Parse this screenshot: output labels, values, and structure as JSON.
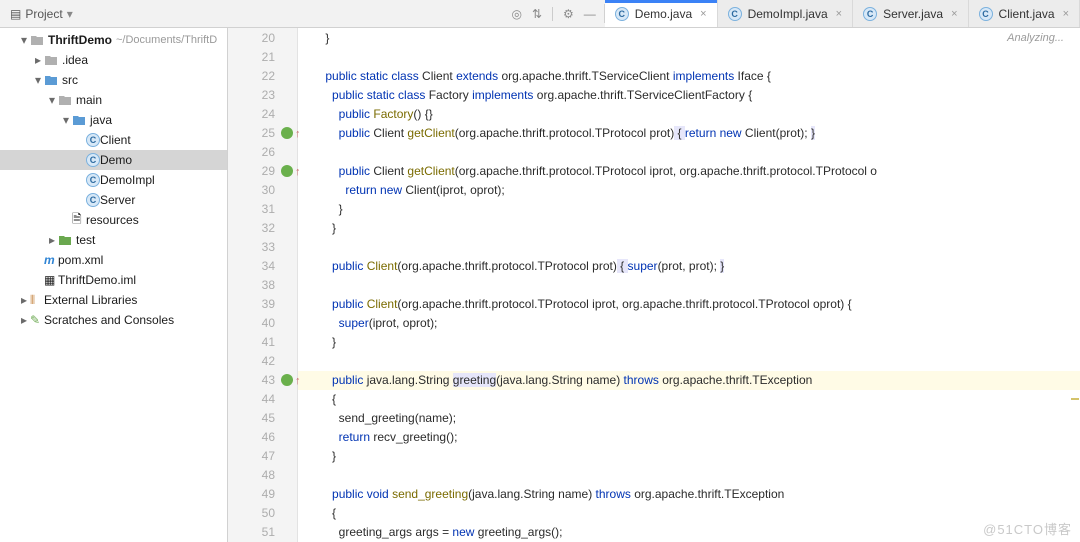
{
  "toolbar": {
    "project_label": "Project",
    "tools": {
      "target": "target-icon",
      "sort": "sort-icon",
      "expand": "expand-icon",
      "gear": "gear-icon",
      "min": "minimize-icon"
    }
  },
  "tabs": [
    {
      "label": "Demo.java",
      "active": true
    },
    {
      "label": "DemoImpl.java",
      "active": false
    },
    {
      "label": "Server.java",
      "active": false
    },
    {
      "label": "Client.java",
      "active": false
    }
  ],
  "tree": {
    "root": {
      "name": "ThriftDemo",
      "path": "~/Documents/ThriftD"
    },
    "items": [
      {
        "indent": 1,
        "twist": "▾",
        "icon": "project",
        "label": "ThriftDemo",
        "sub": "~/Documents/ThriftD",
        "bold": true
      },
      {
        "indent": 2,
        "twist": "▸",
        "icon": "folder",
        "label": ".idea"
      },
      {
        "indent": 2,
        "twist": "▾",
        "icon": "folder-blue",
        "label": "src"
      },
      {
        "indent": 3,
        "twist": "▾",
        "icon": "folder",
        "label": "main"
      },
      {
        "indent": 4,
        "twist": "▾",
        "icon": "folder-blue",
        "label": "java"
      },
      {
        "indent": 5,
        "twist": "",
        "icon": "class",
        "label": "Client"
      },
      {
        "indent": 5,
        "twist": "",
        "icon": "class",
        "label": "Demo",
        "sel": true
      },
      {
        "indent": 5,
        "twist": "",
        "icon": "class",
        "label": "DemoImpl"
      },
      {
        "indent": 5,
        "twist": "",
        "icon": "class",
        "label": "Server"
      },
      {
        "indent": 4,
        "twist": "",
        "icon": "resources",
        "label": "resources"
      },
      {
        "indent": 3,
        "twist": "▸",
        "icon": "folder-green",
        "label": "test"
      },
      {
        "indent": 2,
        "twist": "",
        "icon": "maven",
        "label": "pom.xml"
      },
      {
        "indent": 2,
        "twist": "",
        "icon": "module",
        "label": "ThriftDemo.iml"
      },
      {
        "indent": 1,
        "twist": "▸",
        "icon": "lib",
        "label": "External Libraries"
      },
      {
        "indent": 1,
        "twist": "▸",
        "icon": "scratch",
        "label": "Scratches and Consoles"
      }
    ]
  },
  "editor": {
    "status": "Analyzing...",
    "watermark": "@51CTO博客",
    "lines": [
      {
        "n": 20,
        "tokens": [
          {
            "t": "    ",
            "c": ""
          },
          {
            "t": "}",
            "c": ""
          }
        ]
      },
      {
        "n": 21,
        "tokens": []
      },
      {
        "n": 22,
        "tokens": [
          {
            "t": "    ",
            "c": ""
          },
          {
            "t": "public static class",
            "c": "kw"
          },
          {
            "t": " Client ",
            "c": ""
          },
          {
            "t": "extends",
            "c": "kw"
          },
          {
            "t": " org.apache.thrift.TServiceClient ",
            "c": ""
          },
          {
            "t": "implements",
            "c": "kw"
          },
          {
            "t": " Iface {",
            "c": ""
          }
        ]
      },
      {
        "n": 23,
        "tokens": [
          {
            "t": "      ",
            "c": ""
          },
          {
            "t": "public static class",
            "c": "kw"
          },
          {
            "t": " Factory ",
            "c": ""
          },
          {
            "t": "implements",
            "c": "kw"
          },
          {
            "t": " org.apache.thrift.TServiceClientFactory<Client> {",
            "c": ""
          }
        ]
      },
      {
        "n": 24,
        "tokens": [
          {
            "t": "        ",
            "c": ""
          },
          {
            "t": "public",
            "c": "kw"
          },
          {
            "t": " ",
            "c": ""
          },
          {
            "t": "Factory",
            "c": "fn"
          },
          {
            "t": "() {}",
            "c": ""
          }
        ]
      },
      {
        "n": 25,
        "mark": "green",
        "tokens": [
          {
            "t": "        ",
            "c": ""
          },
          {
            "t": "public",
            "c": "kw"
          },
          {
            "t": " Client ",
            "c": ""
          },
          {
            "t": "getClient",
            "c": "fn"
          },
          {
            "t": "(org.apache.thrift.protocol.TProtocol prot)",
            "c": ""
          },
          {
            "t": " { ",
            "c": "hlw"
          },
          {
            "t": "return new",
            "c": "kw"
          },
          {
            "t": " Client(prot); ",
            "c": ""
          },
          {
            "t": "}",
            "c": "hlw"
          }
        ]
      },
      {
        "n": 26,
        "tokens": []
      },
      {
        "n": 29,
        "mark": "red",
        "tokens": [
          {
            "t": "        ",
            "c": ""
          },
          {
            "t": "public",
            "c": "kw"
          },
          {
            "t": " Client ",
            "c": ""
          },
          {
            "t": "getClient",
            "c": "fn"
          },
          {
            "t": "(org.apache.thrift.protocol.TProtocol iprot, org.apache.thrift.protocol.TProtocol o",
            "c": ""
          }
        ]
      },
      {
        "n": 30,
        "tokens": [
          {
            "t": "          ",
            "c": ""
          },
          {
            "t": "return new",
            "c": "kw"
          },
          {
            "t": " Client(iprot, oprot);",
            "c": ""
          }
        ]
      },
      {
        "n": 31,
        "tokens": [
          {
            "t": "        }",
            "c": ""
          }
        ]
      },
      {
        "n": 32,
        "tokens": [
          {
            "t": "      }",
            "c": ""
          }
        ]
      },
      {
        "n": 33,
        "tokens": []
      },
      {
        "n": 34,
        "tokens": [
          {
            "t": "      ",
            "c": ""
          },
          {
            "t": "public",
            "c": "kw"
          },
          {
            "t": " ",
            "c": ""
          },
          {
            "t": "Client",
            "c": "fn"
          },
          {
            "t": "(org.apache.thrift.protocol.TProtocol prot)",
            "c": ""
          },
          {
            "t": " { ",
            "c": "hlw"
          },
          {
            "t": "super",
            "c": "kw"
          },
          {
            "t": "(prot, prot); ",
            "c": ""
          },
          {
            "t": "}",
            "c": "hlw"
          }
        ]
      },
      {
        "n": 38,
        "tokens": []
      },
      {
        "n": 39,
        "tokens": [
          {
            "t": "      ",
            "c": ""
          },
          {
            "t": "public",
            "c": "kw"
          },
          {
            "t": " ",
            "c": ""
          },
          {
            "t": "Client",
            "c": "fn"
          },
          {
            "t": "(org.apache.thrift.protocol.TProtocol iprot, org.apache.thrift.protocol.TProtocol oprot) {",
            "c": ""
          }
        ]
      },
      {
        "n": 40,
        "tokens": [
          {
            "t": "        ",
            "c": ""
          },
          {
            "t": "super",
            "c": "kw"
          },
          {
            "t": "(iprot, oprot);",
            "c": ""
          }
        ]
      },
      {
        "n": 41,
        "tokens": [
          {
            "t": "      }",
            "c": ""
          }
        ]
      },
      {
        "n": 42,
        "tokens": []
      },
      {
        "n": 43,
        "hl": true,
        "mark": "green",
        "tokens": [
          {
            "t": "      ",
            "c": ""
          },
          {
            "t": "public",
            "c": "kw"
          },
          {
            "t": " java.lang.String ",
            "c": ""
          },
          {
            "t": "greeting",
            "c": "hlw"
          },
          {
            "t": "(java.lang.String name) ",
            "c": ""
          },
          {
            "t": "throws",
            "c": "kw"
          },
          {
            "t": " org.apache.thrift.TException",
            "c": ""
          }
        ]
      },
      {
        "n": 44,
        "tokens": [
          {
            "t": "      {",
            "c": ""
          }
        ]
      },
      {
        "n": 45,
        "tokens": [
          {
            "t": "        send_greeting(name);",
            "c": ""
          }
        ]
      },
      {
        "n": 46,
        "tokens": [
          {
            "t": "        ",
            "c": ""
          },
          {
            "t": "return",
            "c": "kw"
          },
          {
            "t": " recv_greeting();",
            "c": ""
          }
        ]
      },
      {
        "n": 47,
        "tokens": [
          {
            "t": "      }",
            "c": ""
          }
        ]
      },
      {
        "n": 48,
        "tokens": []
      },
      {
        "n": 49,
        "tokens": [
          {
            "t": "      ",
            "c": ""
          },
          {
            "t": "public void",
            "c": "kw"
          },
          {
            "t": " ",
            "c": ""
          },
          {
            "t": "send_greeting",
            "c": "fn"
          },
          {
            "t": "(java.lang.String name) ",
            "c": ""
          },
          {
            "t": "throws",
            "c": "kw"
          },
          {
            "t": " org.apache.thrift.TException",
            "c": ""
          }
        ]
      },
      {
        "n": 50,
        "tokens": [
          {
            "t": "      {",
            "c": ""
          }
        ]
      },
      {
        "n": 51,
        "tokens": [
          {
            "t": "        greeting_args args = ",
            "c": ""
          },
          {
            "t": "new",
            "c": "kw"
          },
          {
            "t": " greeting_args();",
            "c": ""
          }
        ]
      }
    ],
    "visible_numbers": [
      20,
      21,
      22,
      23,
      24,
      25,
      26,
      29,
      30,
      31,
      32,
      33,
      34,
      38,
      39,
      40,
      41,
      42,
      43,
      44,
      45,
      46,
      47,
      48,
      49,
      50,
      51
    ]
  }
}
